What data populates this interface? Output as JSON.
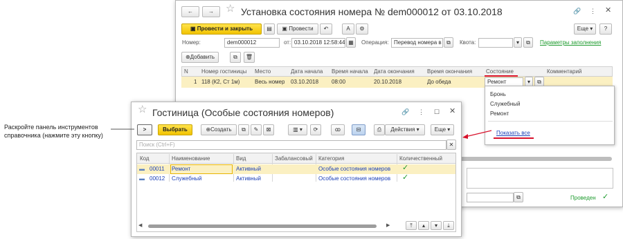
{
  "main_window": {
    "title": "Установка состояния номера № dem000012 от 03.10.2018",
    "post_close": "Провести и закрыть",
    "post": "Провести",
    "more": "Еще",
    "help": "?",
    "number_label": "Номер:",
    "number_value": "dem000012",
    "from_label": "от:",
    "date_value": "03.10.2018 12:58:44",
    "operation_label": "Операция:",
    "operation_value": "Перевод номера в",
    "quota_label": "Квота:",
    "fill_params": "Параметры заполнения",
    "add": "Добавить",
    "columns": [
      "N",
      "Номер гостиницы",
      "Место",
      "Дата начала",
      "Время начала",
      "Дата окончания",
      "Время окончания",
      "Состояние",
      "Комментарий"
    ],
    "row": {
      "n": "1",
      "room": "118 (К2, Ст 1м)",
      "place": "Весь номер",
      "date_start": "03.10.2018",
      "time_start": "08:00",
      "date_end": "20.10.2018",
      "time_end": "До обеда",
      "state": "Ремонт"
    },
    "status_text": "Проведен",
    "dropdown": {
      "items": [
        "Бронь",
        "Служебный",
        "Ремонт"
      ],
      "show_all": "Показать все"
    }
  },
  "sub_window": {
    "title": "Гостиница (Особые состояния номеров)",
    "select": "Выбрать",
    "create": "Создать",
    "actions": "Действия",
    "more": "Еще",
    "search_placeholder": "Поиск (Ctrl+F)",
    "columns": [
      "Код",
      "Наименование",
      "Вид",
      "Забалансовый",
      "Категория",
      "Количественный"
    ],
    "rows": [
      {
        "code": "00011",
        "name": "Ремонт",
        "kind": "Активный",
        "category": "Особые состояния номеров",
        "quantitative": "✓"
      },
      {
        "code": "00012",
        "name": "Служебный",
        "kind": "Активный",
        "category": "Особые состояния номеров",
        "quantitative": "✓"
      }
    ]
  },
  "callout": {
    "text": "Раскройте панель инструментов справочника (нажмите эту кнопку)"
  },
  "colors": {
    "accent_yellow": "#f2c300",
    "selection_row": "#fbf0c2",
    "link_green": "#1e9b2e",
    "link_blue": "#1a3fb8",
    "annotation_red": "#d8102a"
  }
}
